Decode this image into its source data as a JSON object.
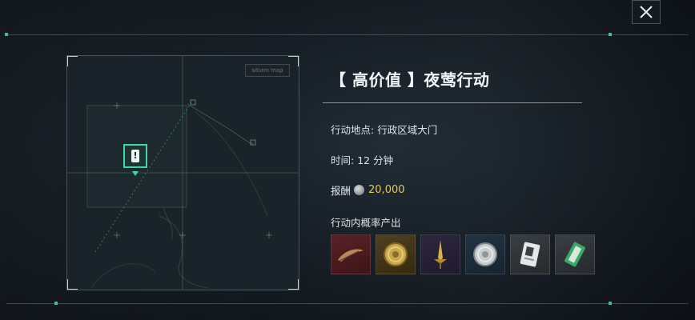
{
  "mission": {
    "title": "【 高价值 】夜莺行动",
    "location_label": "行动地点:",
    "location_value": "行政区域大门",
    "time_label": "时间:",
    "time_value": "12 分钟",
    "reward_label": "报酬",
    "reward_value": "20,000",
    "drops_label": "行动内概率产出"
  },
  "map": {
    "minimap_label": "sitiam map"
  },
  "drops": [
    {
      "icon": "feather-quill-icon"
    },
    {
      "icon": "gold-coin-icon"
    },
    {
      "icon": "golden-dagger-icon"
    },
    {
      "icon": "silver-coin-icon"
    },
    {
      "icon": "id-card-icon"
    },
    {
      "icon": "green-ticket-icon"
    }
  ],
  "colors": {
    "accent": "#3fd7a8",
    "reward": "#e5c860"
  }
}
